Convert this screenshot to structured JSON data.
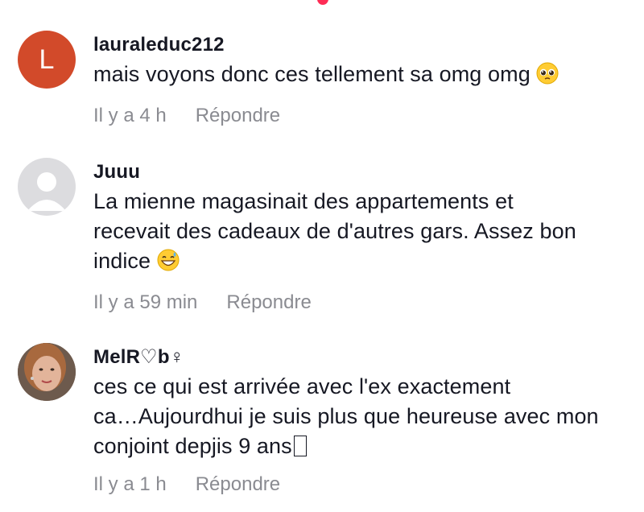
{
  "comments": [
    {
      "avatar_letter": "L",
      "username": "lauraleduc212",
      "text": "mais voyons donc ces tellement sa omg omg",
      "emoji": "pleading-face-emoji",
      "time": "Il y a 4 h",
      "reply_label": "Répondre"
    },
    {
      "username": "Juuu",
      "text_lines": [
        "La mienne magasinait des appartements et",
        "recevait des cadeaux de d'autres gars. Assez bon",
        "indice"
      ],
      "emoji": "grinning-sweat-emoji",
      "time": "Il y a 59 min",
      "reply_label": "Répondre"
    },
    {
      "username": "MelR♡b♀",
      "text_lines": [
        "ces ce qui est arrivée avec l'ex exactement",
        "ca…Aujourdhui je suis plus que heureuse avec mon",
        "conjoint depjis 9 ans"
      ],
      "time": "Il y a 1 h",
      "reply_label": "Répondre"
    }
  ],
  "colors": {
    "accent": "#fe2c55",
    "avatar_l": "#d24a2a",
    "meta": "#8a8b91",
    "text": "#161823"
  }
}
